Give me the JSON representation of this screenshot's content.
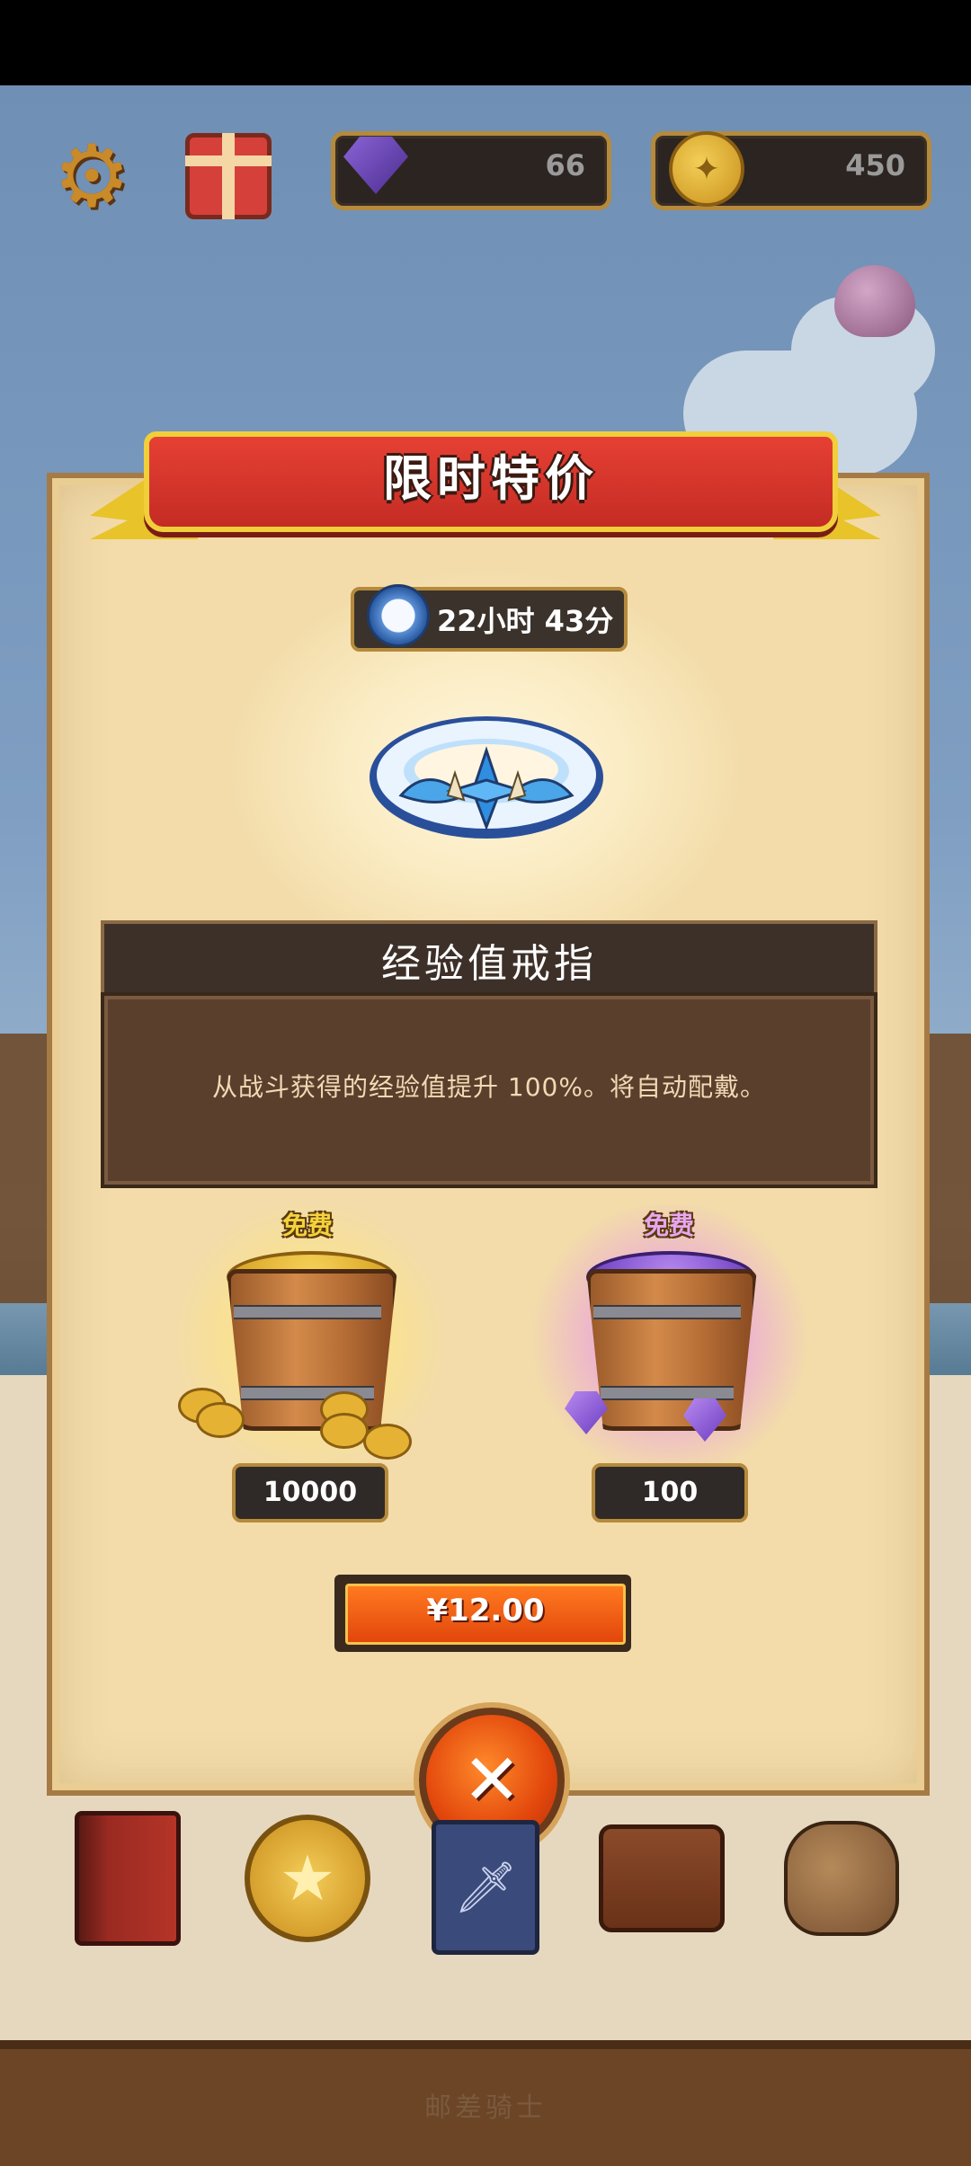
{
  "hud": {
    "gems": "66",
    "coins": "450"
  },
  "offer": {
    "banner_title": "限时特价",
    "timer": "22小时 43分",
    "item_name": "经验值戒指",
    "item_description": "从战斗获得的经验值提升 100%。将自动配戴。",
    "rewards": [
      {
        "label": "免费",
        "amount": "10000",
        "icon": "gold-coin-bucket-icon"
      },
      {
        "label": "免费",
        "amount": "100",
        "icon": "gem-bucket-icon"
      }
    ],
    "price": "¥12.00"
  },
  "footer": {
    "watermark": "邮差骑士"
  },
  "colors": {
    "ribbon": "#e64034",
    "panel": "#f3dcaa",
    "price_button": "#e2460c",
    "timer_bg": "#3a322b"
  },
  "nav_icons": [
    "book-icon",
    "star-coin-icon",
    "card-deck-icon",
    "backpack-icon",
    "treasure-bag-icon"
  ]
}
